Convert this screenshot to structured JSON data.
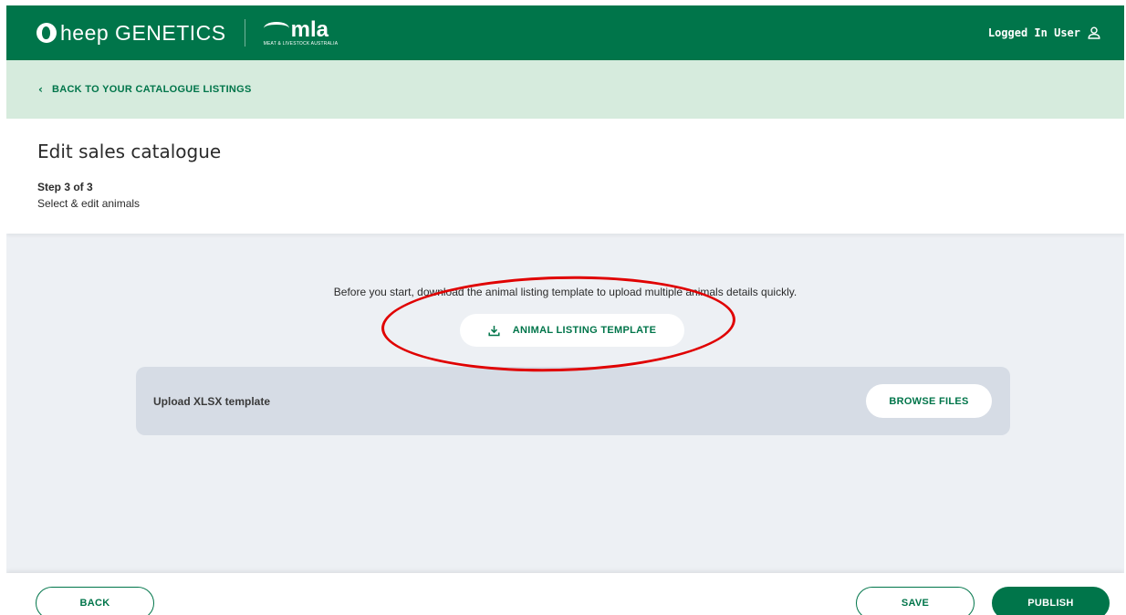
{
  "header": {
    "brand_name": "heep GENETICS",
    "partner_logo_text": "mla",
    "partner_logo_subtitle": "MEAT & LIVESTOCK AUSTRALIA",
    "user_label": "Logged In User",
    "user_icon": "user-icon",
    "brand_color": "#00754a"
  },
  "nav": {
    "back_link_label": "BACK TO YOUR CATALOGUE LISTINGS",
    "back_link_icon": "chevron-left-icon",
    "bar_color": "#d6ebdd"
  },
  "page": {
    "title": "Edit sales catalogue",
    "step_label": "Step 3 of 3",
    "step_description": "Select & edit animals"
  },
  "content": {
    "intro_text": "Before you start, download the animal listing template to upload multiple animals details quickly.",
    "template_button_label": "ANIMAL LISTING TEMPLATE",
    "template_button_icon": "download-icon",
    "upload_label": "Upload XLSX template",
    "browse_button_label": "BROWSE FILES",
    "background_color": "#edf0f4"
  },
  "footer": {
    "back_label": "BACK",
    "save_label": "SAVE",
    "publish_label": "PUBLISH"
  },
  "annotation": {
    "color": "#e00000",
    "target": "ANIMAL LISTING TEMPLATE"
  }
}
